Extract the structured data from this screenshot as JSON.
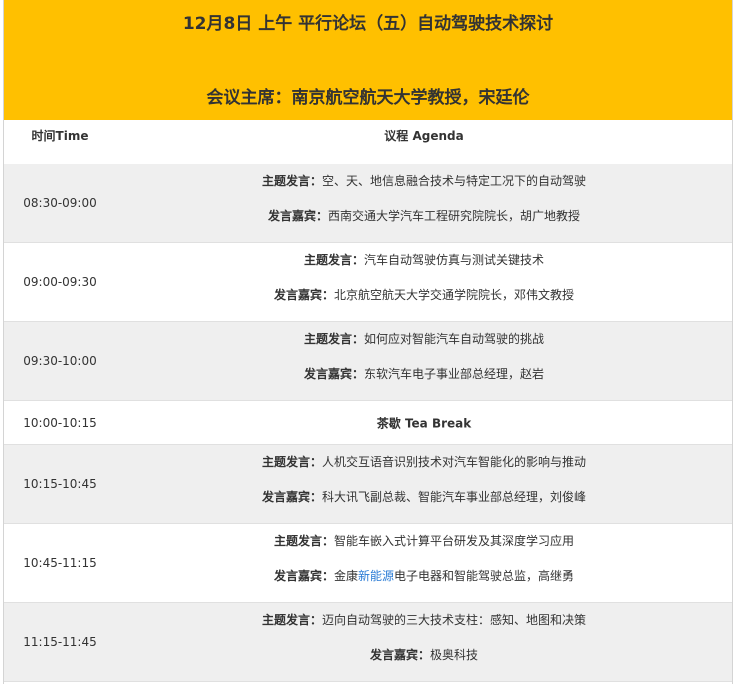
{
  "banner": {
    "title": "12月8日 上午 平行论坛（五）自动驾驶技术探讨",
    "chair": "会议主席：南京航空航天大学教授，宋廷伦"
  },
  "header": {
    "time": "时间Time",
    "agenda": "议程 Agenda"
  },
  "rows": [
    {
      "time": "08:30-09:00",
      "topic_label": "主题发言：",
      "topic": "空、天、地信息融合技术与特定工况下的自动驾驶",
      "speaker_label": "发言嘉宾：",
      "speaker": "西南交通大学汽车工程研究院院长，胡广地教授"
    },
    {
      "time": "09:00-09:30",
      "topic_label": "主题发言：",
      "topic": "汽车自动驾驶仿真与测试关键技术",
      "speaker_label": "发言嘉宾：",
      "speaker": "北京航空航天大学交通学院院长，邓伟文教授"
    },
    {
      "time": "09:30-10:00",
      "topic_label": "主题发言：",
      "topic": "如何应对智能汽车自动驾驶的挑战",
      "speaker_label": "发言嘉宾：",
      "speaker": "东软汽车电子事业部总经理，赵岩"
    },
    {
      "time": "10:00-10:15",
      "break": "茶歇 Tea Break"
    },
    {
      "time": "10:15-10:45",
      "topic_label": "主题发言：",
      "topic": "人机交互语音识别技术对汽车智能化的影响与推动",
      "speaker_label": "发言嘉宾：",
      "speaker": "科大讯飞副总裁、智能汽车事业部总经理，刘俊峰"
    },
    {
      "time": "10:45-11:15",
      "topic_label": "主题发言：",
      "topic": "智能车嵌入式计算平台研发及其深度学习应用",
      "speaker_label": "发言嘉宾：",
      "speaker_pre": "金康",
      "speaker_link": "新能源",
      "speaker_post": "电子电器和智能驾驶总监，高继勇"
    },
    {
      "time": "11:15-11:45",
      "topic_label": "主题发言：",
      "topic": "迈向自动驾驶的三大技术支柱：感知、地图和决策",
      "speaker_label": "发言嘉宾：",
      "speaker": "极奥科技"
    }
  ]
}
